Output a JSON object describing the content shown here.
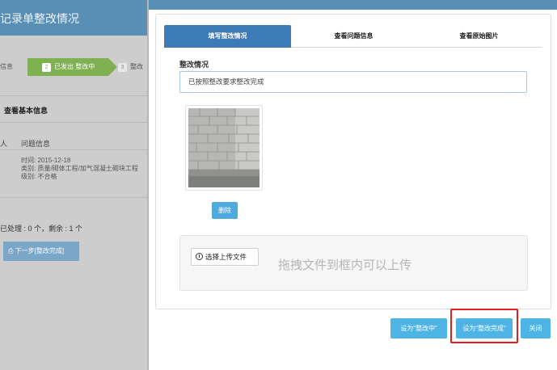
{
  "left_panel": {
    "title": "记录单整改情况",
    "steps": [
      {
        "label": "信息"
      },
      {
        "num": "2",
        "label": "已发出 整改中"
      },
      {
        "num": "3",
        "label": "整改"
      }
    ],
    "section_title": "查看基本信息",
    "col_person": "人",
    "col_info": "问题信息",
    "info": {
      "time": "时间: 2015-12-18",
      "category": "类别: 质量/砌体工程/加气混凝土砌块工程",
      "level": "级别: 不合格"
    },
    "count": "已处理 : 0 个，剩余 : 1 个",
    "next_button": "下一步[整改完成]"
  },
  "modal": {
    "tabs": [
      {
        "label": "填写整改情况",
        "active": true
      },
      {
        "label": "查看问题信息",
        "active": false
      },
      {
        "label": "查看原始图片",
        "active": false
      }
    ],
    "field_label": "整改情况",
    "field_value": "已按照整改要求整改完成",
    "delete_button": "删除",
    "upload_button": "选择上传文件",
    "drop_hint": "拖拽文件到框内可以上传",
    "actions": {
      "set_in_progress": "设为“整改中”",
      "set_complete": "设为“整改完成”",
      "close": "关闭"
    }
  },
  "colors": {
    "header_blue": "#5a8fb5",
    "tab_active": "#3d7ab8",
    "button_blue": "#4eb4e6",
    "step_green": "#7fb052",
    "highlight_red": "#e02020"
  }
}
